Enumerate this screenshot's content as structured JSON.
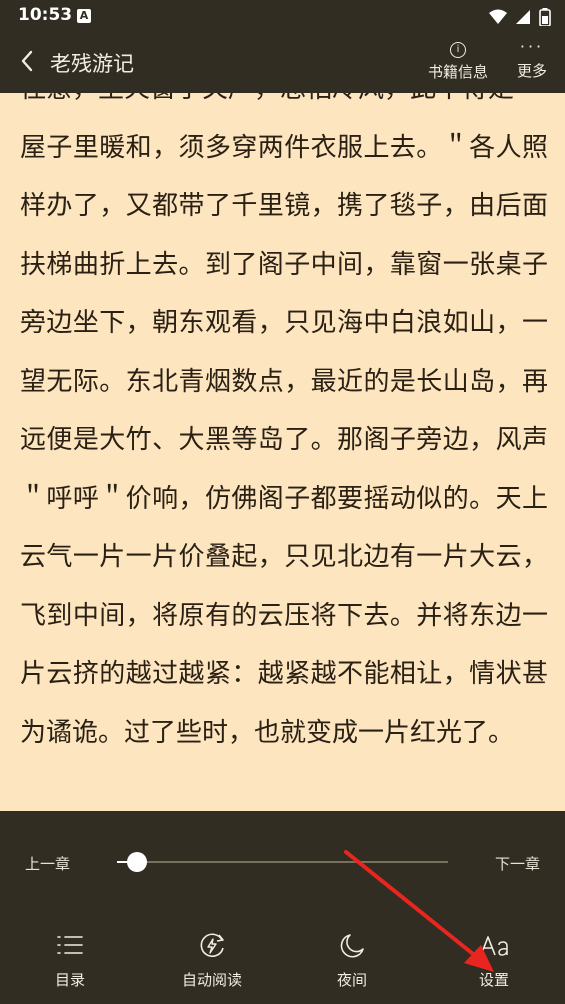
{
  "status": {
    "time": "10:53",
    "notif_letter": "A"
  },
  "header": {
    "title": "老残游记",
    "info_label": "书籍信息",
    "more_label": "更多"
  },
  "content": {
    "paragraphs": [
      "住意，生火窗子关严，总怕冷风，此不得是",
      "屋子里暖和，须多穿两件衣服上去。＂各人照样办了，又都带了千里镜，携了毯子，由后面扶梯曲折上去。到了阁子中间，靠窗一张桌子旁边坐下，朝东观看，只见海中白浪如山，一望无际。东北青烟数点，最近的是长山岛，再远便是大竹、大黑等岛了。那阁子旁边，风声＂呼呼＂价响，仿佛阁子都要摇动似的。天上云气一片一片价叠起，只见北边有一片大云，飞到中间，将原有的云压将下去。并将东边一片云挤的越过越紧：越紧越不能相让，情状甚为谲诡。过了些时，也就变成一片红光了。"
    ]
  },
  "progress": {
    "prev_label": "上一章",
    "next_label": "下一章",
    "value": 0.06
  },
  "menu": {
    "items": [
      {
        "label": "目录",
        "icon": "list-icon"
      },
      {
        "label": "自动阅读",
        "icon": "auto-read-icon"
      },
      {
        "label": "夜间",
        "icon": "moon-icon"
      },
      {
        "label": "设置",
        "icon": "font-settings-icon"
      }
    ]
  },
  "annotation": {
    "color": "#e8261f"
  }
}
